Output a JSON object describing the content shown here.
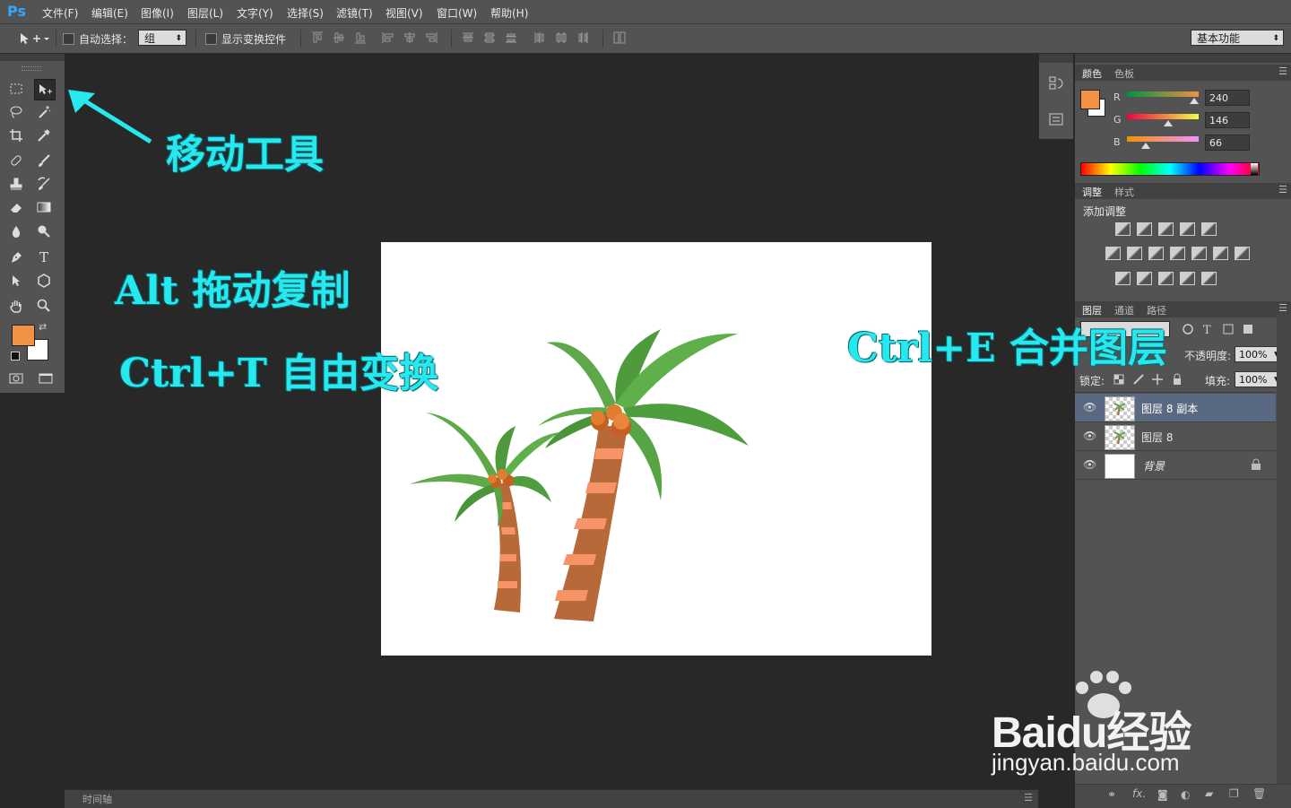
{
  "app": {
    "logo": "Ps"
  },
  "menu": [
    "文件(F)",
    "编辑(E)",
    "图像(I)",
    "图层(L)",
    "文字(Y)",
    "选择(S)",
    "滤镜(T)",
    "视图(V)",
    "窗口(W)",
    "帮助(H)"
  ],
  "options": {
    "auto_select_label": "自动选择：",
    "auto_select_value": "组",
    "show_transform_label": "显示变换控件",
    "workspace": "基本功能"
  },
  "annotations": {
    "move_tool": "移动工具",
    "alt_drag": "Alt 拖动复制",
    "ctrl_t": "Ctrl+T 自由变换",
    "ctrl_e": "Ctrl+E 合并图层"
  },
  "color_panel": {
    "tabs": [
      "颜色",
      "色板"
    ],
    "r_label": "R",
    "g_label": "G",
    "b_label": "B",
    "r": "240",
    "g": "146",
    "b": "66",
    "r_level": 0.94,
    "g_level": 0.57,
    "b_level": 0.26,
    "foreground": "#f09242",
    "background": "#ffffff"
  },
  "adjust_panel": {
    "tabs": [
      "调整",
      "样式"
    ],
    "title": "添加调整"
  },
  "layers_panel": {
    "tabs": [
      "图层",
      "通道",
      "路径"
    ],
    "opacity_label": "不透明度:",
    "opacity": "100%",
    "lock_label": "锁定:",
    "fill_label": "填充:",
    "fill": "100%",
    "layers": [
      {
        "name": "图层 8 副本",
        "selected": true
      },
      {
        "name": "图层 8",
        "selected": false
      },
      {
        "name": "背景",
        "selected": false
      }
    ]
  },
  "timeline": {
    "label": "时间轴"
  },
  "watermark": {
    "brand": "Baidu经验",
    "url": "jingyan.baidu.com"
  }
}
